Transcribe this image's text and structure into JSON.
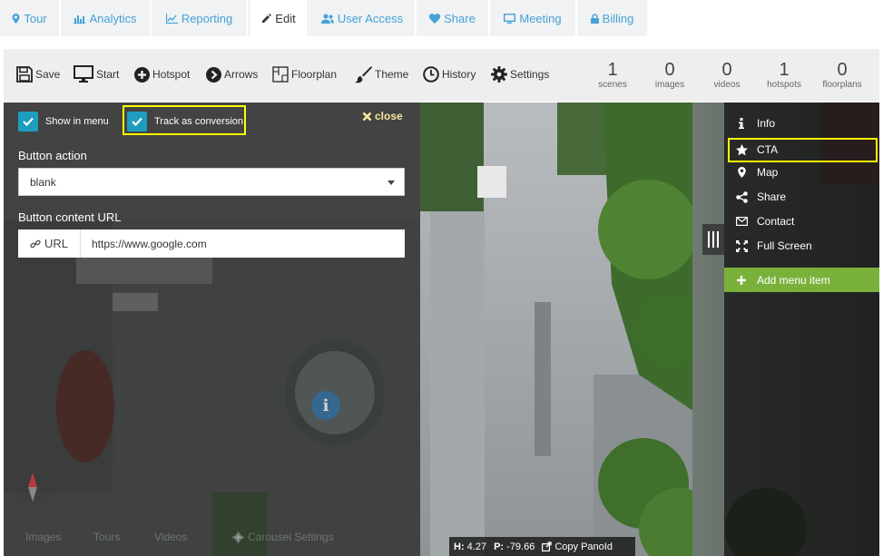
{
  "tabs": [
    {
      "label": "Tour",
      "icon": "map-marker-icon"
    },
    {
      "label": "Analytics",
      "icon": "bar-chart-icon"
    },
    {
      "label": "Reporting",
      "icon": "line-chart-icon"
    },
    {
      "label": "Edit",
      "icon": "pencil-icon",
      "active": true
    },
    {
      "label": "User Access",
      "icon": "users-icon"
    },
    {
      "label": "Share",
      "icon": "heart-icon"
    },
    {
      "label": "Meeting",
      "icon": "monitor-icon"
    },
    {
      "label": "Billing",
      "icon": "lock-icon"
    }
  ],
  "toolbar": {
    "save": "Save",
    "start": "Start",
    "hotspot": "Hotspot",
    "arrows": "Arrows",
    "floorplan": "Floorplan",
    "theme": "Theme",
    "history": "History",
    "settings": "Settings"
  },
  "stats": [
    {
      "value": "1",
      "label": "scenes"
    },
    {
      "value": "0",
      "label": "images"
    },
    {
      "value": "0",
      "label": "videos"
    },
    {
      "value": "1",
      "label": "hotspots"
    },
    {
      "value": "0",
      "label": "floorplans"
    }
  ],
  "editor": {
    "show_in_menu": "Show in menu",
    "track_as_conversion": "Track as conversion",
    "close": "close",
    "button_action_label": "Button action",
    "button_action_value": "blank",
    "button_url_label": "Button content URL",
    "url_addon": "URL",
    "url_value": "https://www.google.com"
  },
  "bottom_tabs": {
    "images": "Images",
    "tours": "Tours",
    "videos": "Videos",
    "carousel_settings": "Carousel Settings"
  },
  "info_hotspot": "i",
  "menu": {
    "items": [
      {
        "label": "Info",
        "icon": "info-icon"
      },
      {
        "label": "CTA",
        "icon": "star-icon"
      },
      {
        "label": "Map",
        "icon": "map-marker-icon"
      },
      {
        "label": "Share",
        "icon": "share-icon"
      },
      {
        "label": "Contact",
        "icon": "envelope-icon"
      },
      {
        "label": "Full Screen",
        "icon": "fullscreen-icon"
      }
    ],
    "add_item": "Add menu item"
  },
  "status": {
    "h_label": "H:",
    "h_value": "4.27",
    "p_label": "P:",
    "p_value": "-79.66",
    "copy": "Copy PanoId"
  },
  "colors": {
    "tab_text": "#45a2d8",
    "checkbox": "#1e9dbf",
    "highlight": "#ffff00",
    "close": "#f5e79e",
    "add_item": "#7ab13b"
  }
}
